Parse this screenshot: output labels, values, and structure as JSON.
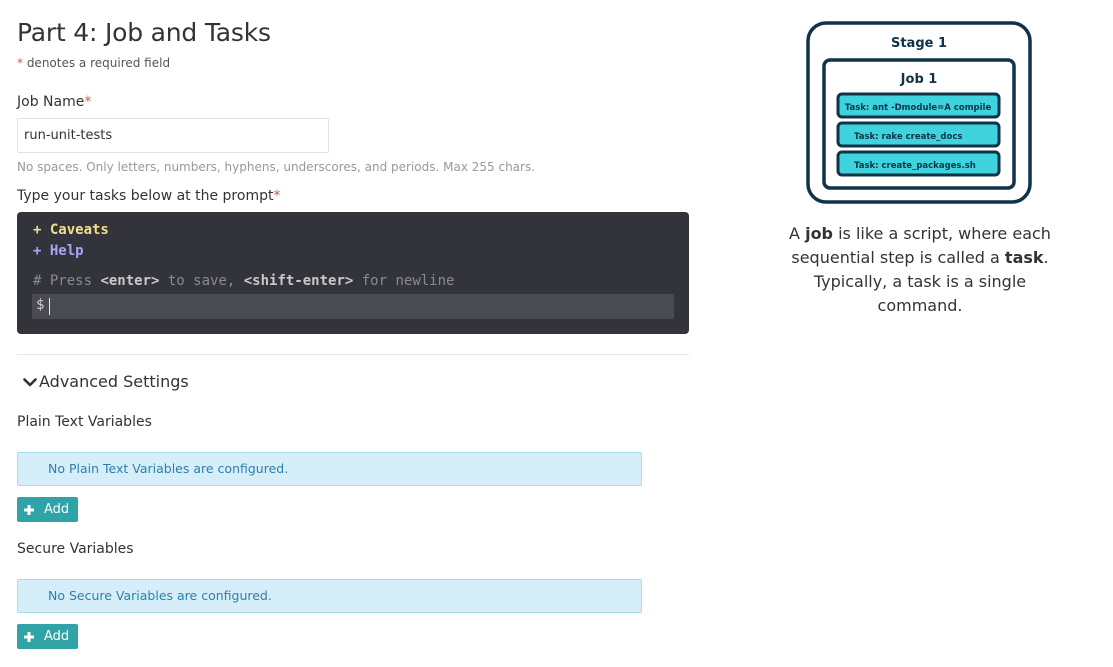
{
  "page": {
    "title": "Part 4: Job and Tasks",
    "required_star": "*",
    "required_note": " denotes a required field"
  },
  "job_name": {
    "label": "Job Name",
    "star": "*",
    "value": "run-unit-tests",
    "help": "No spaces. Only letters, numbers, hyphens, underscores, and periods. Max 255 chars."
  },
  "tasks": {
    "label": "Type your tasks below at the prompt",
    "star": "*",
    "terminal": {
      "caveats": "+ Caveats",
      "help": "+ Help",
      "comment_prefix": "# Press ",
      "enter_key": "<enter>",
      "comment_middle": " to save, ",
      "shift_enter_key": "<shift-enter>",
      "comment_suffix": " for newline",
      "prompt": "$"
    }
  },
  "advanced": {
    "toggle_label": "Advanced Settings",
    "plain_vars": {
      "title": "Plain Text Variables",
      "empty_message": "No Plain Text Variables are configured.",
      "add_label": "Add"
    },
    "secure_vars": {
      "title": "Secure Variables",
      "empty_message": "No Secure Variables are configured.",
      "add_label": "Add"
    }
  },
  "diagram": {
    "stage": "Stage 1",
    "job": "Job 1",
    "tasks": [
      "Task: ant -Dmodule=A compile",
      "Task: rake create_docs",
      "Task: create_packages.sh"
    ],
    "colors": {
      "outline": "#0f3347",
      "task_fill": "#3fd3dd"
    }
  },
  "caption": {
    "p1": "A ",
    "b1": "job",
    "p2": " is like a script, where each sequential step is called a ",
    "b2": "task",
    "p3": ". Typically, a task is a single command."
  },
  "colors": {
    "terminal_bg": "#32333b",
    "button": "#2fa3a5",
    "info_bg": "#d5eefa",
    "info_text": "#2d80a8",
    "required": "#d9534f"
  }
}
